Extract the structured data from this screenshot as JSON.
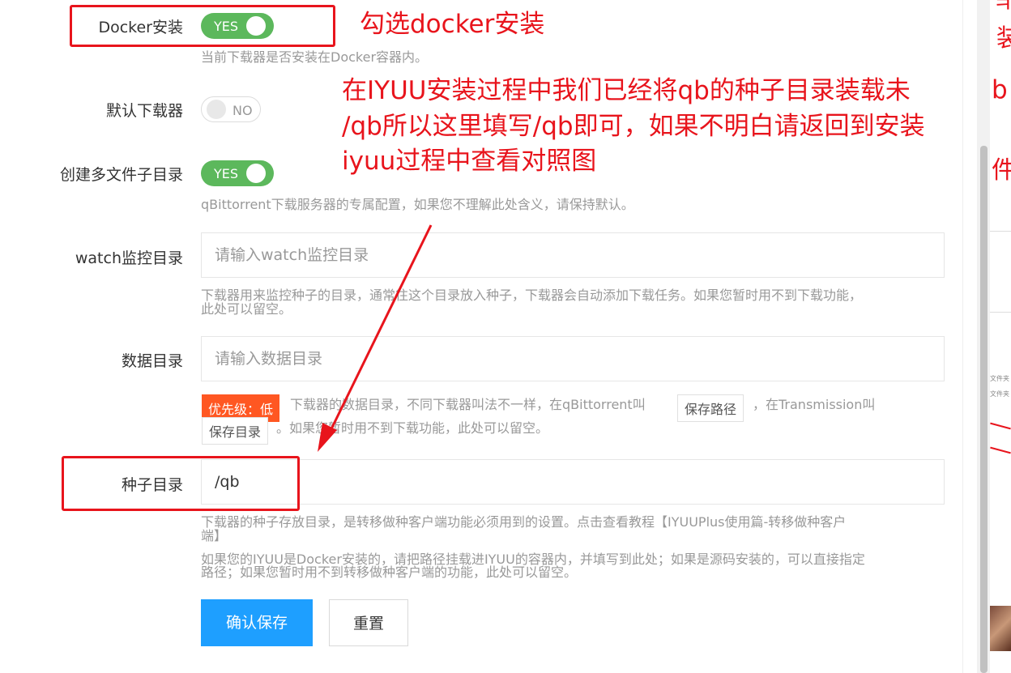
{
  "form": {
    "docker_install": {
      "label": "Docker安装",
      "toggle": "YES",
      "help": "当前下载器是否安装在Docker容器内。"
    },
    "default_downloader": {
      "label": "默认下载器",
      "toggle": "NO"
    },
    "multi_file_dir": {
      "label": "创建多文件子目录",
      "toggle": "YES",
      "help": "qBittorrent下载服务器的专属配置，如果您不理解此处含义，请保持默认。"
    },
    "watch_dir": {
      "label": "watch监控目录",
      "placeholder": "请输入watch监控目录",
      "help_line1": "下载器用来监控种子的目录，通常往这个目录放入种子，下载器会自动添加下载任务。如果您暂时用不到下载功能，",
      "help_line2": "此处可以留空。"
    },
    "data_dir": {
      "label": "数据目录",
      "placeholder": "请输入数据目录",
      "priority_badge": "优先级：低",
      "help_part1": "下载器的数据目录，不同下载器叫法不一样，在qBittorrent叫",
      "tag1": "保存路径",
      "help_part2": "，在Transmission叫",
      "tag2": "保存目录",
      "help_part3": "。如果您暂时用不到下载功能，此处可以留空。"
    },
    "seed_dir": {
      "label": "种子目录",
      "value": "/qb",
      "help1_line1": "下载器的种子存放目录，是转移做种客户端功能必须用到的设置。点击查看教程【IYUUPlus使用篇-转移做种客户",
      "help1_line2": "端】",
      "help2_line1": "如果您的IYUU是Docker安装的，请把路径挂载进IYUU的容器内，并填写到此处；如果是源码安装的，可以直接指定",
      "help2_line2": "路径；如果您暂时用不到转移做种客户端的功能，此处可以留空。"
    },
    "buttons": {
      "save": "确认保存",
      "reset": "重置"
    }
  },
  "annotations": {
    "docker_note": "勾选docker安装",
    "seed_note_line1": "在IYUU安装过程中我们已经将qb的种子目录装载未",
    "seed_note_line2": "/qb所以这里填写/qb即可，如果不明白请返回到安装",
    "seed_note_line3": "iyuu过程中查看对照图"
  },
  "side_fragments": {
    "frag_a": "ㅋ",
    "frag_b": "装",
    "frag_c": "b",
    "frag_d": "件",
    "frag_e": "文件夹",
    "frag_f": "文件夹"
  },
  "colors": {
    "annotation_red": "#e8141c",
    "toggle_on": "#5cb85c",
    "primary_button": "#1e9fff",
    "priority_badge": "#ff5722"
  }
}
